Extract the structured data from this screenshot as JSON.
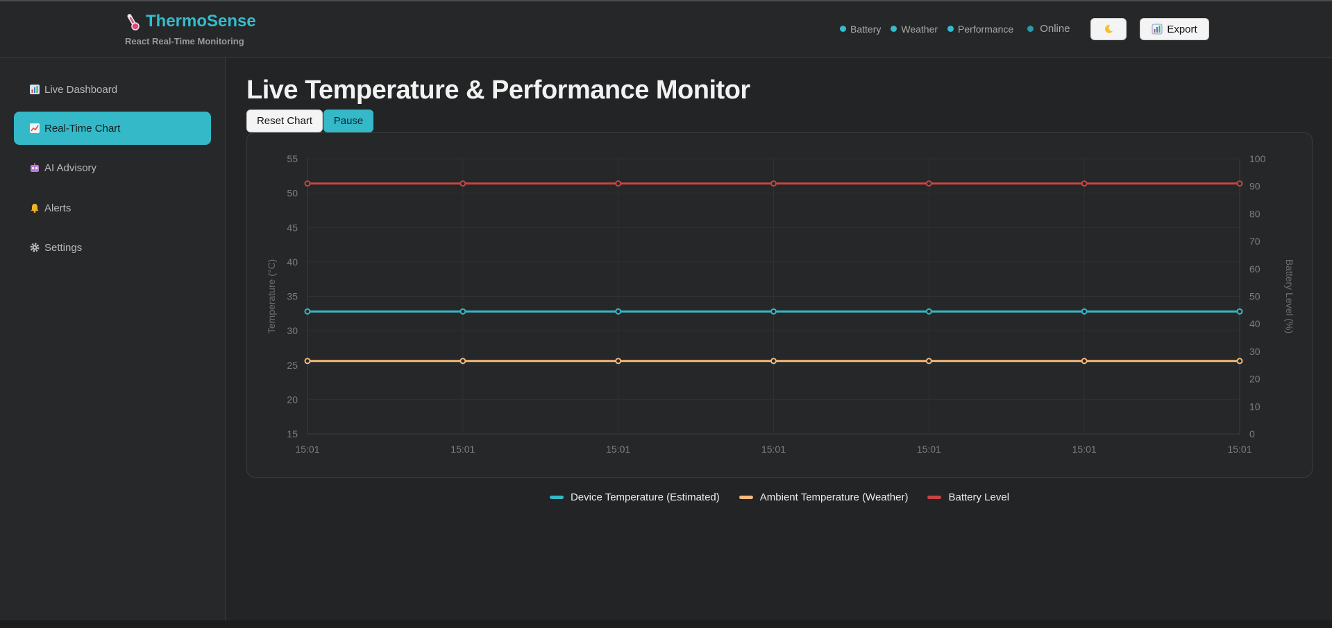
{
  "app": {
    "title": "ThermoSense",
    "subtitle": "React Real-Time Monitoring",
    "logo_icon": "thermometer-icon"
  },
  "header": {
    "status_items": [
      {
        "label": "Battery",
        "color": "#35bccc"
      },
      {
        "label": "Weather",
        "color": "#35bccc"
      },
      {
        "label": "Performance",
        "color": "#35bccc"
      }
    ],
    "online_label": "Online",
    "theme_icon": "moon-icon",
    "export_label": "Export",
    "export_icon": "chart-icon"
  },
  "sidebar": {
    "items": [
      {
        "label": "Live Dashboard",
        "icon": "bar-chart-icon",
        "active": false
      },
      {
        "label": "Real-Time Chart",
        "icon": "line-chart-icon",
        "active": true
      },
      {
        "label": "AI Advisory",
        "icon": "robot-icon",
        "active": false
      },
      {
        "label": "Alerts",
        "icon": "bell-icon",
        "active": false
      },
      {
        "label": "Settings",
        "icon": "gear-icon",
        "active": false
      }
    ]
  },
  "main": {
    "title": "Live Temperature & Performance Monitor",
    "reset_label": "Reset Chart",
    "pause_label": "Pause"
  },
  "colors": {
    "accent": "#33b9c7",
    "device": "#36b8c9",
    "ambient": "#f5b97a",
    "battery": "#c94440"
  },
  "chart_data": {
    "type": "line",
    "x": [
      "15:01",
      "15:01",
      "15:01",
      "15:01",
      "15:01",
      "15:01",
      "15:01"
    ],
    "series": [
      {
        "name": "Device Temperature (Estimated)",
        "axis": "left",
        "color": "#36b8c9",
        "values": [
          32.8,
          32.8,
          32.8,
          32.8,
          32.8,
          32.8,
          32.8
        ]
      },
      {
        "name": "Ambient Temperature (Weather)",
        "axis": "left",
        "color": "#f5b97a",
        "values": [
          25.6,
          25.6,
          25.6,
          25.6,
          25.6,
          25.6,
          25.6
        ]
      },
      {
        "name": "Battery Level",
        "axis": "right",
        "color": "#c94440",
        "values": [
          91,
          91,
          91,
          91,
          91,
          91,
          91
        ]
      }
    ],
    "ylabel": "Temperature (°C)",
    "y2label": "Battery Level (%)",
    "ylim": [
      15,
      55
    ],
    "yticks": [
      15,
      20,
      25,
      30,
      35,
      40,
      45,
      50,
      55
    ],
    "y2lim": [
      0,
      100
    ],
    "y2ticks": [
      0,
      10,
      20,
      30,
      40,
      50,
      60,
      70,
      80,
      90,
      100
    ],
    "grid": true,
    "legend_position": "bottom"
  }
}
